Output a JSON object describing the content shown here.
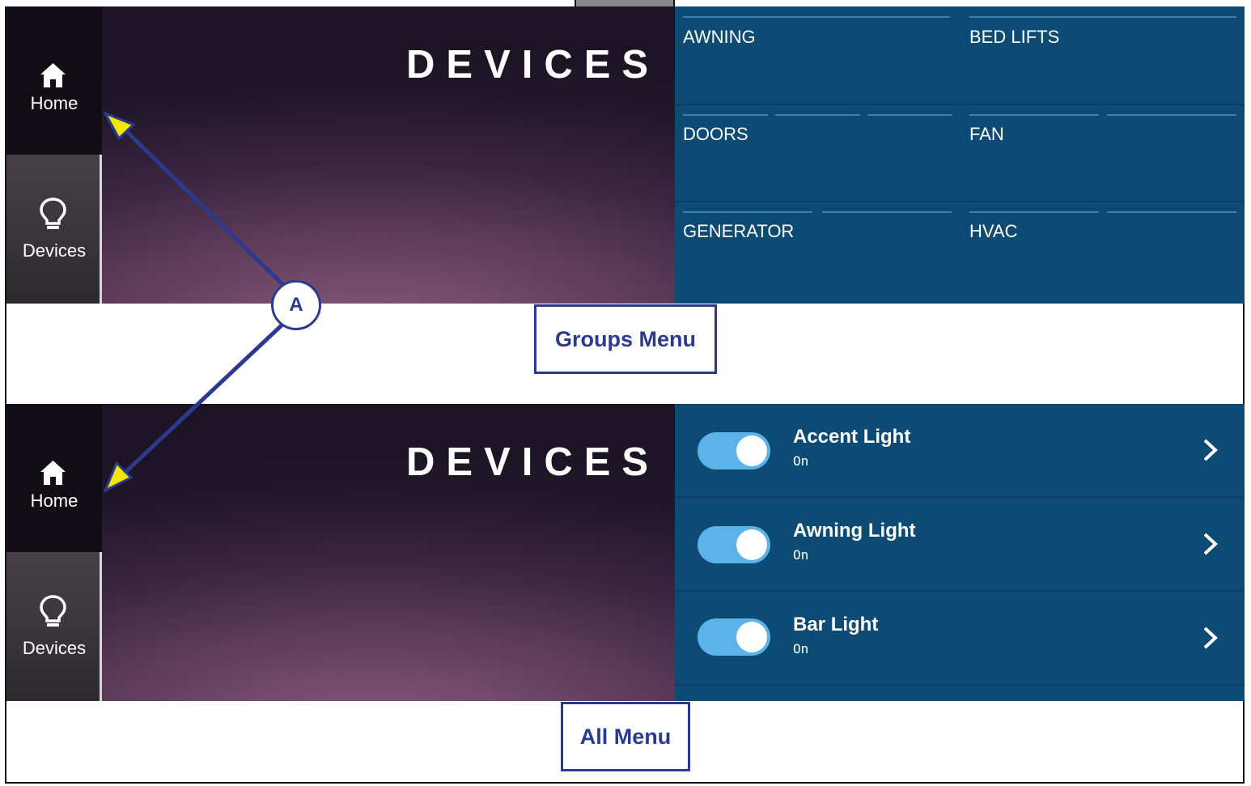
{
  "nav": {
    "home_label": "Home",
    "home_icon": "home-icon",
    "devices_label": "Devices",
    "devices_icon": "lightbulb-icon"
  },
  "title": "DEVICES",
  "groups": [
    {
      "label": "AWNING"
    },
    {
      "label": "BED LIFTS"
    },
    {
      "label": "DOORS"
    },
    {
      "label": "FAN"
    },
    {
      "label": "GENERATOR"
    },
    {
      "label": "HVAC"
    }
  ],
  "devices": [
    {
      "name": "Accent Light",
      "state": "On",
      "toggle": true
    },
    {
      "name": "Awning Light",
      "state": "On",
      "toggle": true
    },
    {
      "name": "Bar Light",
      "state": "On",
      "toggle": true
    }
  ],
  "callout": "A",
  "captions": {
    "groups": "Groups Menu",
    "all": "All Menu"
  },
  "colors": {
    "panel_blue": "#0d4a74",
    "toggle_on": "#5bb3ea",
    "annotation_blue": "#2b3a8f",
    "arrow_tip": "#f5e600"
  }
}
